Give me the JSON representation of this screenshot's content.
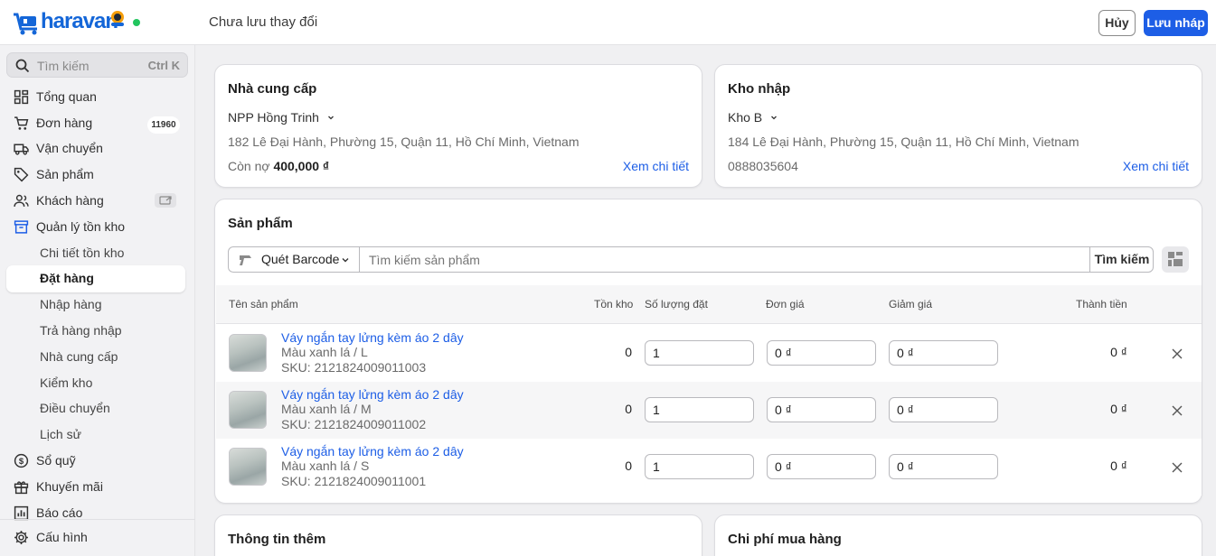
{
  "topbar": {
    "logo_text": "haravan",
    "status": "Chưa lưu thay đổi",
    "cancel_label": "Hủy",
    "save_label": "Lưu nháp"
  },
  "sidebar": {
    "search_placeholder": "Tìm kiếm",
    "search_shortcut": "Ctrl K",
    "items": [
      {
        "label": "Tổng quan",
        "icon": "dashboard-icon"
      },
      {
        "label": "Đơn hàng",
        "icon": "cart-icon",
        "badge": "11960"
      },
      {
        "label": "Vận chuyển",
        "icon": "truck-icon"
      },
      {
        "label": "Sản phẩm",
        "icon": "tag-icon"
      },
      {
        "label": "Khách hàng",
        "icon": "users-icon"
      },
      {
        "label": "Quản lý tồn kho",
        "icon": "inventory-icon",
        "active": true
      },
      {
        "label": "Sổ quỹ",
        "icon": "cashbook-icon"
      },
      {
        "label": "Khuyến mãi",
        "icon": "gift-icon"
      },
      {
        "label": "Báo cáo",
        "icon": "report-icon"
      }
    ],
    "subitems": [
      "Chi tiết tồn kho",
      "Đặt hàng",
      "Nhập hàng",
      "Trả hàng nhập",
      "Nhà cung cấp",
      "Kiểm kho",
      "Điều chuyển",
      "Lịch sử"
    ],
    "active_subitem": "Đặt hàng",
    "settings_label": "Cấu hình"
  },
  "supplier": {
    "title": "Nhà cung cấp",
    "name": "NPP Hồng Trinh",
    "address": "182 Lê Đại Hành, Phường 15, Quận 11, Hồ Chí Minh, Vietnam",
    "debt_label": "Còn nợ",
    "debt_value": "400,000 ₫",
    "detail_link": "Xem chi tiết"
  },
  "warehouse": {
    "title": "Kho nhập",
    "name": "Kho B",
    "address": "184 Lê Đại Hành, Phường 15, Quận 11, Hồ Chí Minh, Vietnam",
    "phone": "0888035604",
    "detail_link": "Xem chi tiết"
  },
  "products": {
    "title": "Sản phẩm",
    "barcode_label": "Quét Barcode",
    "search_placeholder": "Tìm kiếm sản phẩm",
    "search_button": "Tìm kiếm",
    "columns": [
      "Tên sản phẩm",
      "Tồn kho",
      "Số lượng đặt",
      "Đơn giá",
      "Giảm giá",
      "Thành tiền"
    ],
    "rows": [
      {
        "name": "Váy ngắn tay lửng kèm áo 2 dây",
        "variant": "Màu xanh lá / L",
        "sku": "SKU: 2121824009011003",
        "stock": "0",
        "qty": "1",
        "price": "0 ₫",
        "discount": "0 ₫",
        "total": "0 ₫"
      },
      {
        "name": "Váy ngắn tay lửng kèm áo 2 dây",
        "variant": "Màu xanh lá / M",
        "sku": "SKU: 2121824009011002",
        "stock": "0",
        "qty": "1",
        "price": "0 ₫",
        "discount": "0 ₫",
        "total": "0 ₫"
      },
      {
        "name": "Váy ngắn tay lửng kèm áo 2 dây",
        "variant": "Màu xanh lá / S",
        "sku": "SKU: 2121824009011001",
        "stock": "0",
        "qty": "1",
        "price": "0 ₫",
        "discount": "0 ₫",
        "total": "0 ₫"
      }
    ]
  },
  "extra": {
    "title": "Thông tin thêm"
  },
  "costs": {
    "title": "Chi phí mua hàng"
  },
  "colors": {
    "primary": "#1d5ee6",
    "status_online": "#22c55e",
    "background": "#f0f0f2"
  }
}
